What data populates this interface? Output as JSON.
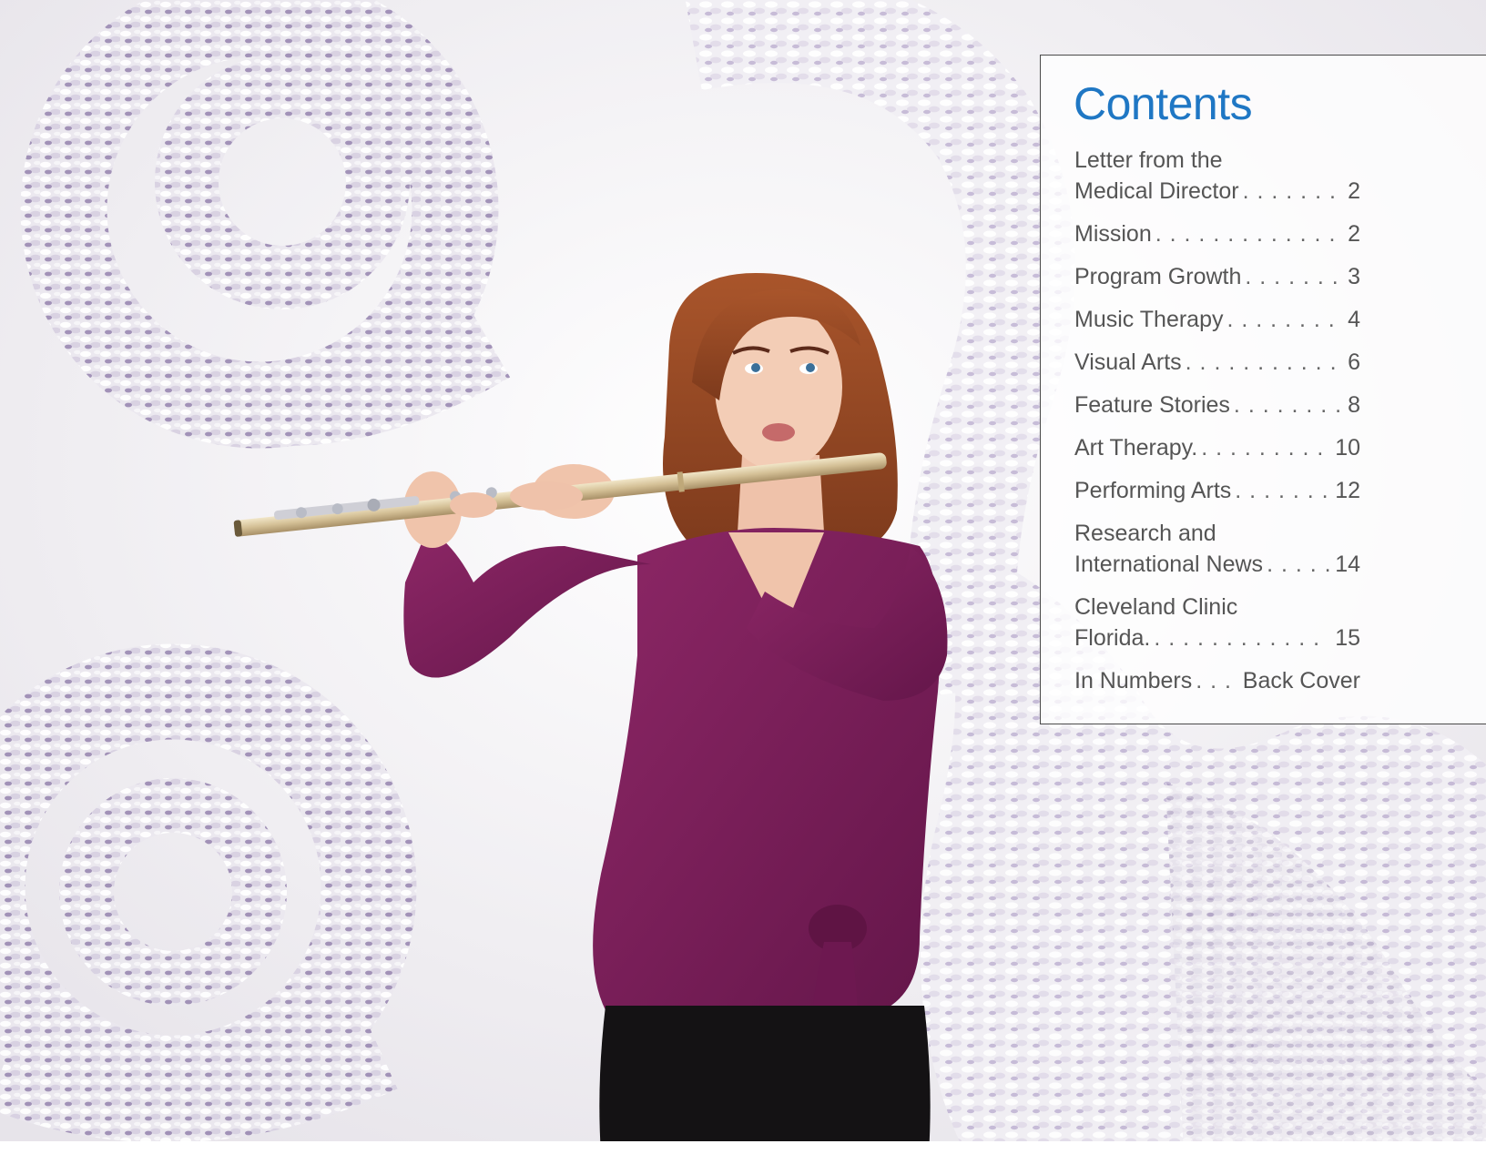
{
  "contents": {
    "title": "Contents",
    "items": [
      {
        "line1": "Letter from the",
        "label": "Medical Director",
        "page": "2"
      },
      {
        "label": "Mission",
        "page": "2"
      },
      {
        "label": "Program Growth",
        "page": "3"
      },
      {
        "label": "Music Therapy",
        "page": "4"
      },
      {
        "label": "Visual Arts",
        "page": "6"
      },
      {
        "label": "Feature Stories",
        "page": "8"
      },
      {
        "label": "Art Therapy.",
        "page": "10"
      },
      {
        "label": "Performing Arts",
        "page": "12"
      },
      {
        "line1": "Research and",
        "label": "International News",
        "page": "14"
      },
      {
        "line1": "Cleveland Clinic",
        "label": "Florida.",
        "page": "15"
      },
      {
        "label": "In Numbers",
        "page": "Back Cover"
      }
    ]
  },
  "colors": {
    "title": "#1f77c4",
    "text": "#555555",
    "blouse": "#7a1f57",
    "hair": "#9a4a26",
    "flute": "#d9c9a4",
    "sculpture": "#b9b0c8"
  },
  "photo": {
    "subject": "flutist-photo"
  }
}
